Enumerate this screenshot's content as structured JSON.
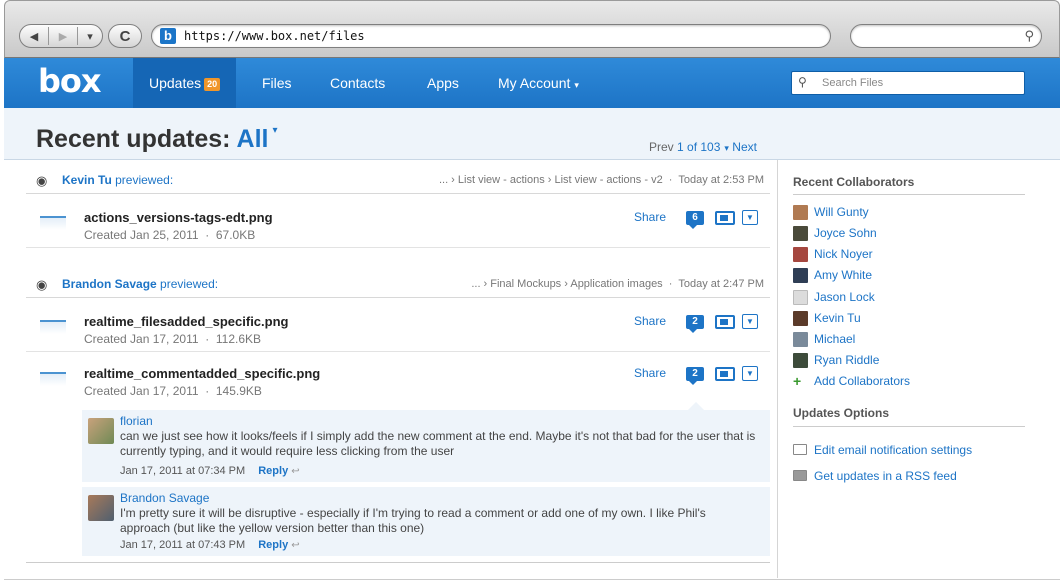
{
  "browser": {
    "url": "https://www.box.net/files",
    "favicon": "b",
    "back_icon": "◀",
    "forward_icon": "▶",
    "menu_icon": "▾",
    "reload_icon": "C",
    "search_icon": "⚲"
  },
  "app": {
    "logo": "box",
    "nav": [
      {
        "label": "Updates",
        "badge": "20"
      },
      {
        "label": "Files"
      },
      {
        "label": "Contacts"
      },
      {
        "label": "Apps"
      },
      {
        "label": "My Account"
      }
    ],
    "search_placeholder": "Search Files"
  },
  "title": {
    "prefix": "Recent updates:",
    "filter": "All"
  },
  "pager": {
    "prev": "Prev",
    "range": "1 of 103",
    "next": "Next"
  },
  "activities": [
    {
      "name": "Kevin Tu",
      "verb": "previewed:",
      "path": "... › List view - actions › List view - actions - v2",
      "time": "Today at 2:53 PM",
      "files": [
        {
          "name": "actions_versions-tags-edt.png",
          "created": "Created Jan 25, 2011",
          "size": "67.0KB",
          "share": "Share",
          "comments": "6"
        }
      ]
    },
    {
      "name": "Brandon Savage",
      "verb": "previewed:",
      "path": "... › Final Mockups › Application images",
      "time": "Today at 2:47 PM",
      "files": [
        {
          "name": "realtime_filesadded_specific.png",
          "created": "Created Jan 17, 2011",
          "size": "112.6KB",
          "share": "Share",
          "comments": "2"
        },
        {
          "name": "realtime_commentadded_specific.png",
          "created": "Created Jan 17, 2011",
          "size": "145.9KB",
          "share": "Share",
          "comments": "2"
        }
      ]
    }
  ],
  "comments": [
    {
      "author": "florian",
      "text": "can we just see how it looks/feels if I simply add the new comment at the end. Maybe it's not that bad for the user that is currently typing, and it would require less clicking from the user",
      "time": "Jan 17, 2011 at 07:34 PM",
      "reply": "Reply"
    },
    {
      "author": "Brandon Savage",
      "text": "I'm pretty sure it will be disruptive - especially if I'm trying to read a comment or add one of my own. I like Phil's approach (but like the yellow version better than this one)",
      "time": "Jan 17, 2011 at 07:43 PM",
      "reply": "Reply"
    }
  ],
  "sidebar": {
    "collab_heading": "Recent Collaborators",
    "collaborators": [
      "Will Gunty",
      "Joyce Sohn",
      "Nick Noyer",
      "Amy White",
      "Jason Lock",
      "Kevin Tu",
      "Michael",
      "Ryan Riddle"
    ],
    "add_collab": "Add Collaborators",
    "options_heading": "Updates Options",
    "options": [
      "Edit email notification settings",
      "Get updates in a RSS feed"
    ]
  },
  "colors": {
    "brand_blue": "#1d74c6",
    "badge_orange": "#f0962a",
    "band_bg": "#eef4fa"
  }
}
